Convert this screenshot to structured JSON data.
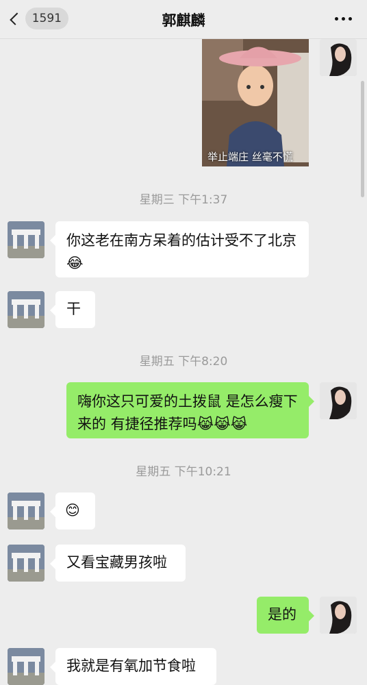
{
  "header": {
    "unread_count": "1591",
    "title": "郭麒麟"
  },
  "photo_message": {
    "caption": "举止端庄 丝毫不慌"
  },
  "timestamps": [
    "星期三 下午1:37",
    "星期五 下午8:20",
    "星期五 下午10:21"
  ],
  "messages": [
    {
      "text": "你这老在南方呆着的估计受不了北京",
      "emoji": "😂"
    },
    {
      "text": "干"
    },
    {
      "text": "嗨你这只可爱的土拨鼠 是怎么瘦下来的 有捷径推荐吗",
      "emoji": "😹😹😹"
    },
    {
      "text": "",
      "emoji": "😊"
    },
    {
      "text": "又看宝藏男孩啦"
    },
    {
      "text": "是的"
    },
    {
      "text": "我就是有氧加节食啦"
    }
  ]
}
